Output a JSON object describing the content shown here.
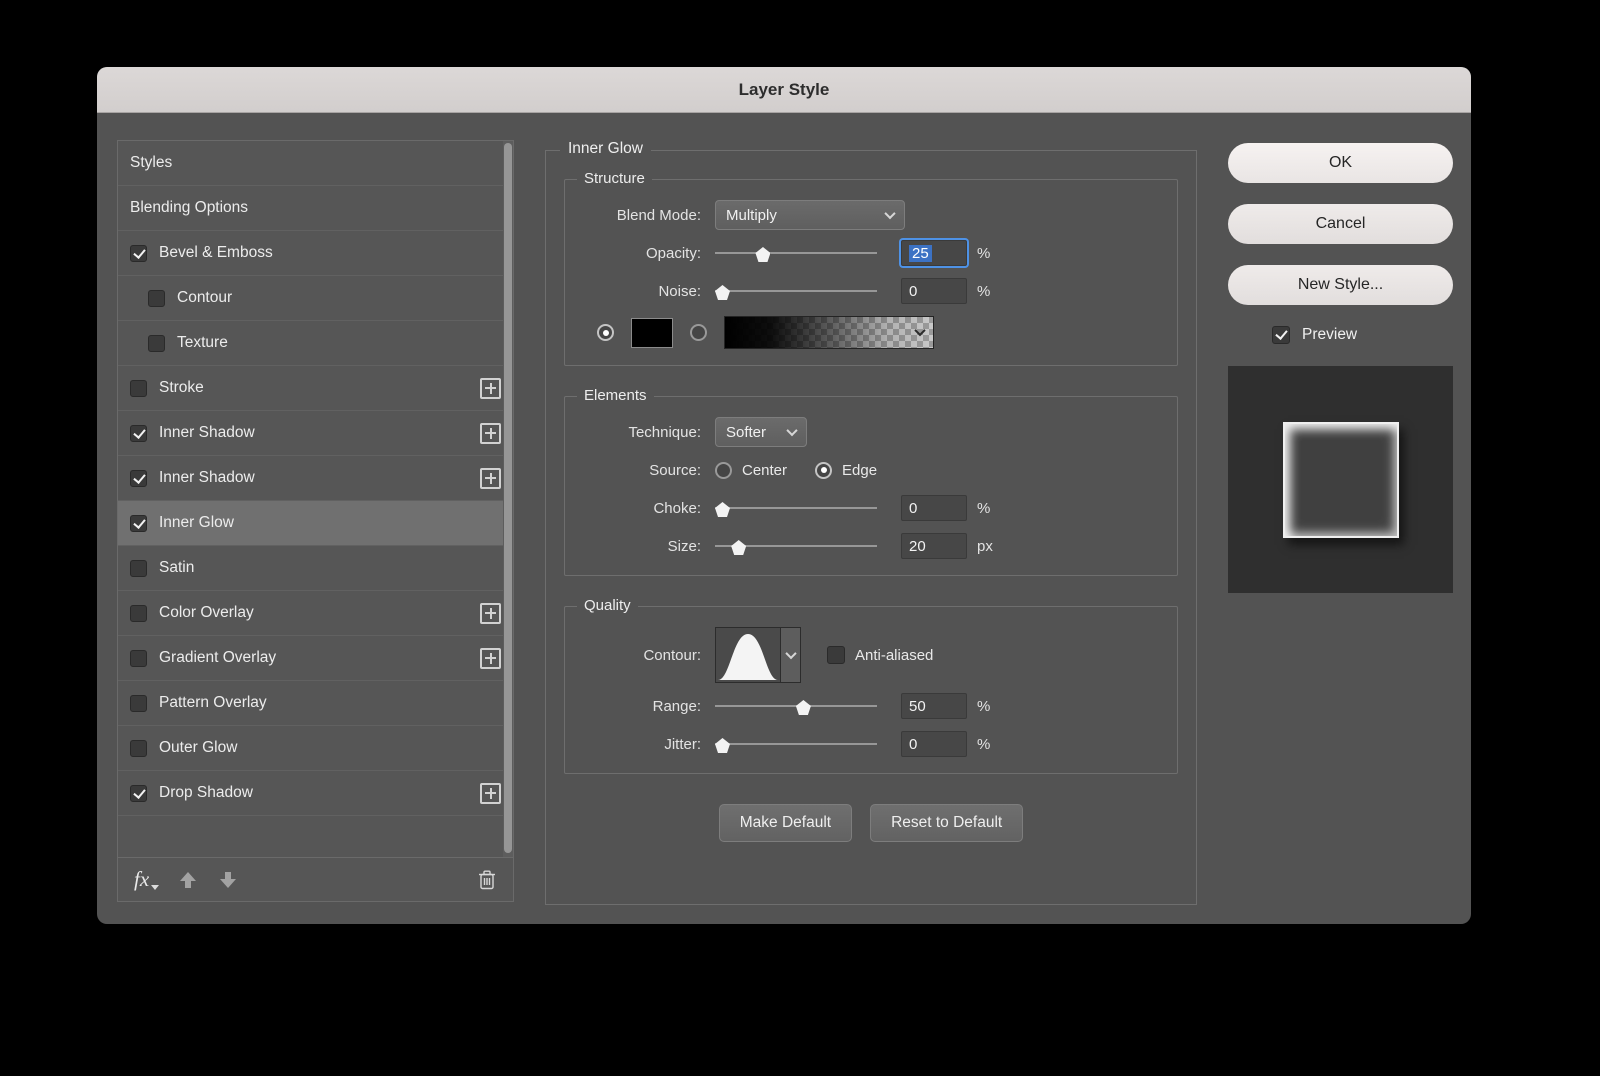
{
  "window": {
    "title": "Layer Style"
  },
  "sidebar": {
    "items": [
      {
        "label": "Styles"
      },
      {
        "label": "Blending Options"
      },
      {
        "label": "Bevel & Emboss",
        "checked": true
      },
      {
        "label": "Contour",
        "checked": false
      },
      {
        "label": "Texture",
        "checked": false
      },
      {
        "label": "Stroke",
        "checked": false,
        "has_add": true
      },
      {
        "label": "Inner Shadow",
        "checked": true,
        "has_add": true
      },
      {
        "label": "Inner Shadow",
        "checked": true,
        "has_add": true
      },
      {
        "label": "Inner Glow",
        "checked": true,
        "selected": true
      },
      {
        "label": "Satin",
        "checked": false
      },
      {
        "label": "Color Overlay",
        "checked": false,
        "has_add": true
      },
      {
        "label": "Gradient Overlay",
        "checked": false,
        "has_add": true
      },
      {
        "label": "Pattern Overlay",
        "checked": false
      },
      {
        "label": "Outer Glow",
        "checked": false
      },
      {
        "label": "Drop Shadow",
        "checked": true,
        "has_add": true
      }
    ],
    "footer": {
      "fx_label": "fx"
    }
  },
  "panel": {
    "title": "Inner Glow",
    "structure": {
      "legend": "Structure",
      "blend_mode_label": "Blend Mode:",
      "blend_mode_value": "Multiply",
      "opacity_label": "Opacity:",
      "opacity_value": "25",
      "opacity_unit": "%",
      "opacity_pct": 25,
      "noise_label": "Noise:",
      "noise_value": "0",
      "noise_unit": "%",
      "noise_pct": 0,
      "fill_type_selected": "color",
      "color_swatch": "#000000"
    },
    "elements": {
      "legend": "Elements",
      "technique_label": "Technique:",
      "technique_value": "Softer",
      "source_label": "Source:",
      "source_center": "Center",
      "source_edge": "Edge",
      "source_selected": "Edge",
      "choke_label": "Choke:",
      "choke_value": "0",
      "choke_unit": "%",
      "choke_pct": 0,
      "size_label": "Size:",
      "size_value": "20",
      "size_unit": "px",
      "size_pct": 10
    },
    "quality": {
      "legend": "Quality",
      "contour_label": "Contour:",
      "anti_aliased_label": "Anti-aliased",
      "anti_aliased_checked": false,
      "range_label": "Range:",
      "range_value": "50",
      "range_unit": "%",
      "range_pct": 50,
      "jitter_label": "Jitter:",
      "jitter_value": "0",
      "jitter_unit": "%",
      "jitter_pct": 0
    },
    "buttons": {
      "make_default": "Make Default",
      "reset_to_default": "Reset to Default"
    }
  },
  "actions": {
    "ok": "OK",
    "cancel": "Cancel",
    "new_style": "New Style...",
    "preview_label": "Preview",
    "preview_checked": true
  },
  "colors": {
    "dialog_bg": "#535353",
    "titlebar_bg": "#d7d3d2",
    "selected_row": "#707070",
    "focus_ring": "#4e92e6",
    "selection_blue": "#3c72c4"
  }
}
